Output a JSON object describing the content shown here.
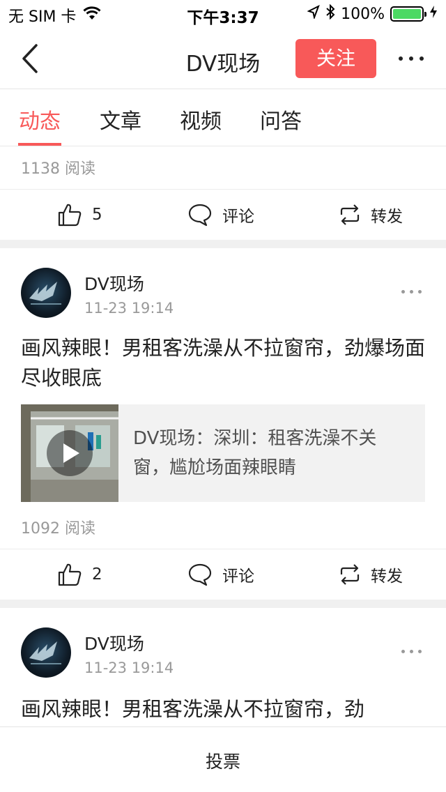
{
  "status_bar": {
    "carrier": "无 SIM 卡",
    "time": "下午3:37",
    "battery": "100%",
    "battery_level": 1.0,
    "battery_color": "#4cd964"
  },
  "nav": {
    "back_icon": "chevron-left-icon",
    "title": "DV现场",
    "follow_label": "关注",
    "more_icon": "ellipsis-icon",
    "accent_color": "#f85959"
  },
  "tabs": [
    {
      "label": "动态",
      "active": true
    },
    {
      "label": "文章",
      "active": false
    },
    {
      "label": "视频",
      "active": false
    },
    {
      "label": "问答",
      "active": false
    }
  ],
  "feed": {
    "top_read_count": "1138 阅读",
    "top_actions": {
      "likes": "5",
      "comment": "评论",
      "share": "转发"
    },
    "posts": [
      {
        "author": "DV现场",
        "time": "11-23 19:14",
        "text": "画风辣眼！男租客洗澡从不拉窗帘，劲爆场面尽收眼底",
        "card_title": "DV现场：深圳：租客洗澡不关窗，尴尬场面辣眼睛",
        "read_count": "1092 阅读",
        "actions": {
          "likes": "2",
          "comment": "评论",
          "share": "转发"
        }
      },
      {
        "author": "DV现场",
        "time": "11-23 19:14",
        "text": "画风辣眼！男租客洗澡从不拉窗帘，劲"
      }
    ]
  },
  "bottom_bar": {
    "vote_label": "投票"
  }
}
